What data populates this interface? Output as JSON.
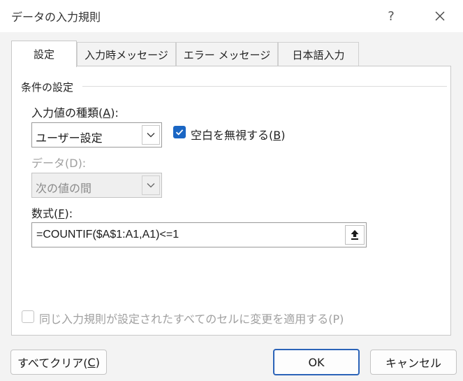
{
  "window": {
    "title": "データの入力規則",
    "help_label": "?",
    "close_label": "✕"
  },
  "tabs": [
    {
      "label": "設定",
      "active": true
    },
    {
      "label": "入力時メッセージ",
      "active": false
    },
    {
      "label": "エラー メッセージ",
      "active": false
    },
    {
      "label": "日本語入力",
      "active": false
    }
  ],
  "settings": {
    "group_label": "条件の設定",
    "allow": {
      "label_pre": "入力値の種類(",
      "key": "A",
      "label_post": "):",
      "value": "ユーザー設定"
    },
    "ignore_blank": {
      "label_pre": "空白を無視する(",
      "key": "B",
      "label_post": ")",
      "checked": true
    },
    "data": {
      "label": "データ(D):",
      "value": "次の値の間",
      "enabled": false
    },
    "formula": {
      "label_pre": "数式(",
      "key": "F",
      "label_post": "):",
      "value": "=COUNTIF($A$1:A1,A1)<=1"
    },
    "apply_all": {
      "label": "同じ入力規則が設定されたすべてのセルに変更を適用する(P)",
      "checked": false,
      "enabled": false
    }
  },
  "buttons": {
    "clear_pre": "すべてクリア(",
    "clear_key": "C",
    "clear_post": ")",
    "ok": "OK",
    "cancel": "キャンセル"
  },
  "colors": {
    "accent": "#1a66c4",
    "default_button_border": "#2b63b8"
  },
  "icons": {
    "dropdown": "chevron-down-icon",
    "collapse": "collapse-dialog-icon",
    "check": "check-icon"
  }
}
